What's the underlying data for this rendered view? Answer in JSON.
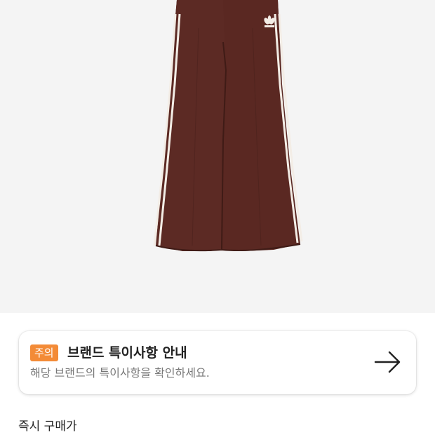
{
  "product": {
    "image_icon": "brown-wide-leg-track-pants-with-white-stripes",
    "logo": "adidas",
    "colors": {
      "pants": "#5c2a24",
      "stripe": "#f3ede6",
      "background": "#f4f4f4"
    }
  },
  "notice": {
    "badge": "주의",
    "title": "브랜드 특이사항 안내",
    "description": "해당 브랜드의 특이사항을 확인하세요.",
    "arrow_icon": "arrow-right-icon",
    "badge_color": "#f38b37"
  },
  "price_section": {
    "label": "즉시 구매가"
  }
}
